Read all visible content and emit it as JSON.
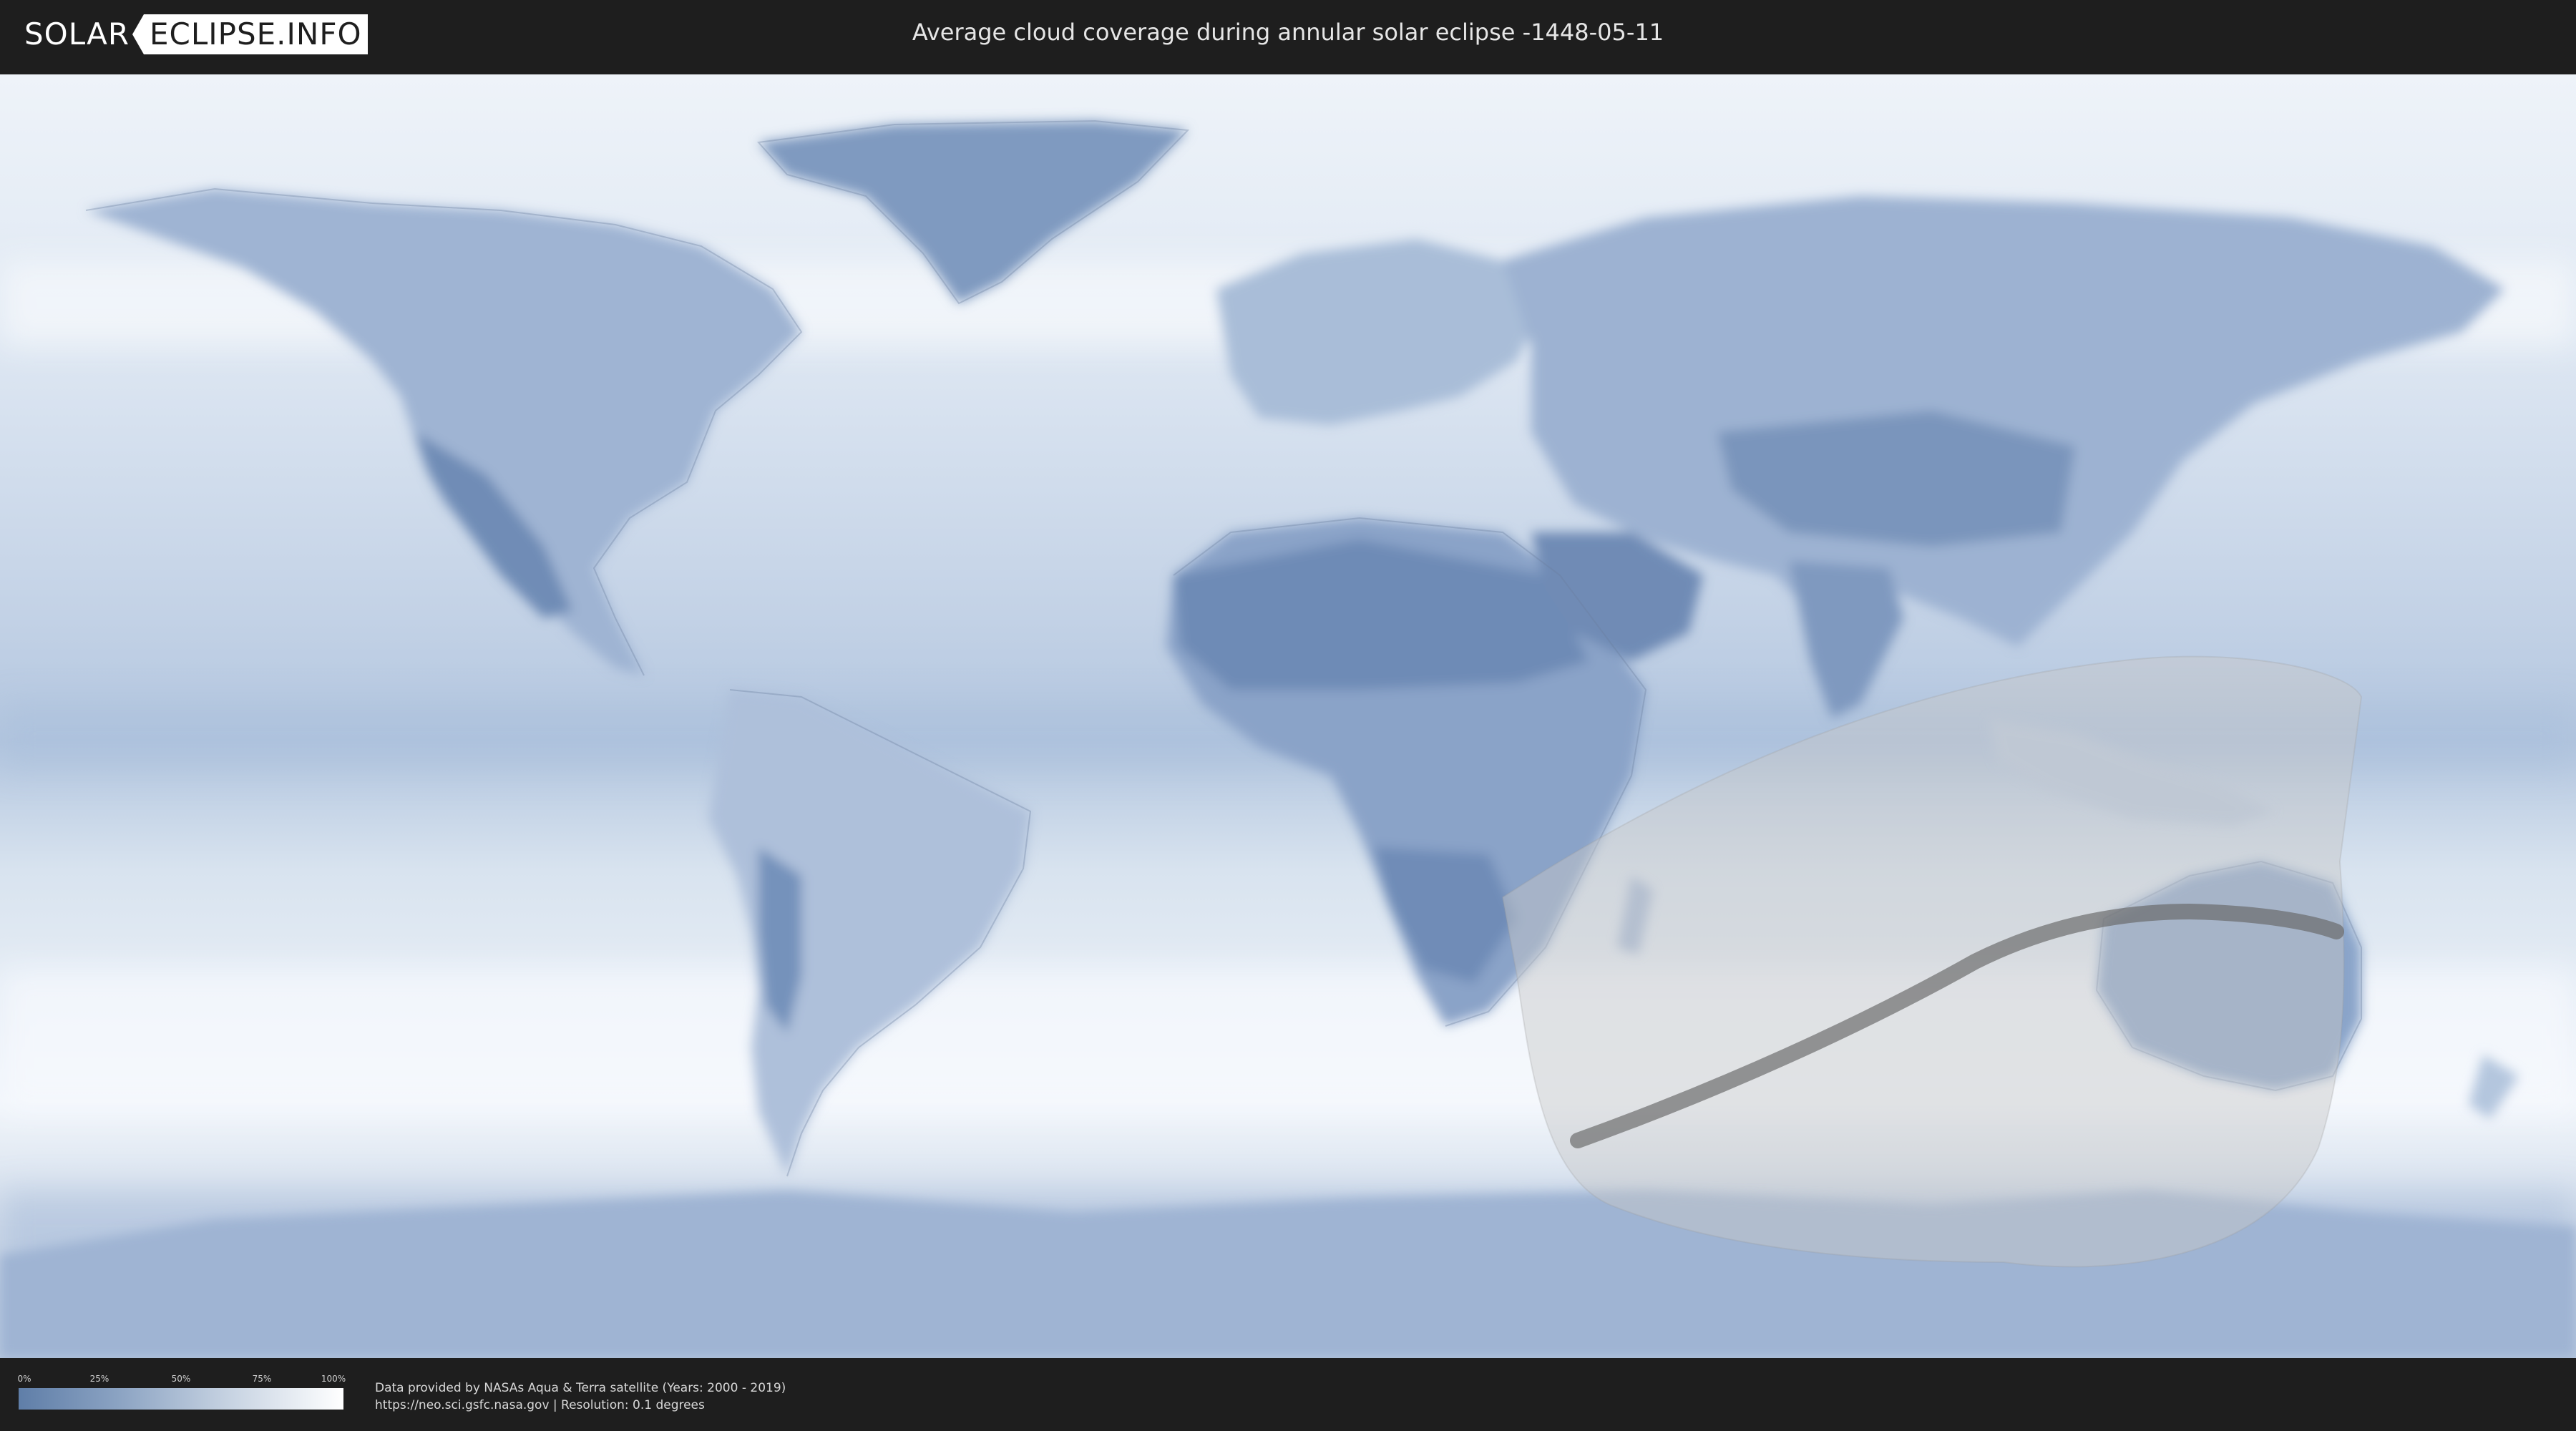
{
  "header": {
    "logo_part1": "SOLAR",
    "logo_part2": "ECLIPSE.INFO",
    "title": "Average cloud coverage during annular solar eclipse -1448-05-11"
  },
  "legend": {
    "ticks": [
      "0%",
      "25%",
      "50%",
      "75%",
      "100%"
    ]
  },
  "credits": {
    "line1": "Data provided by NASAs Aqua & Terra satellite (Years: 2000 - 2019)",
    "line2": "https://neo.sci.gsfc.nasa.gov | Resolution: 0.1 degrees"
  },
  "colors": {
    "header_bg": "#1e1e1e",
    "cloud_low": "#5f7ea8",
    "cloud_high": "#ffffff",
    "eclipse_zone": "#c8c8c8",
    "central_path": "#555555"
  }
}
